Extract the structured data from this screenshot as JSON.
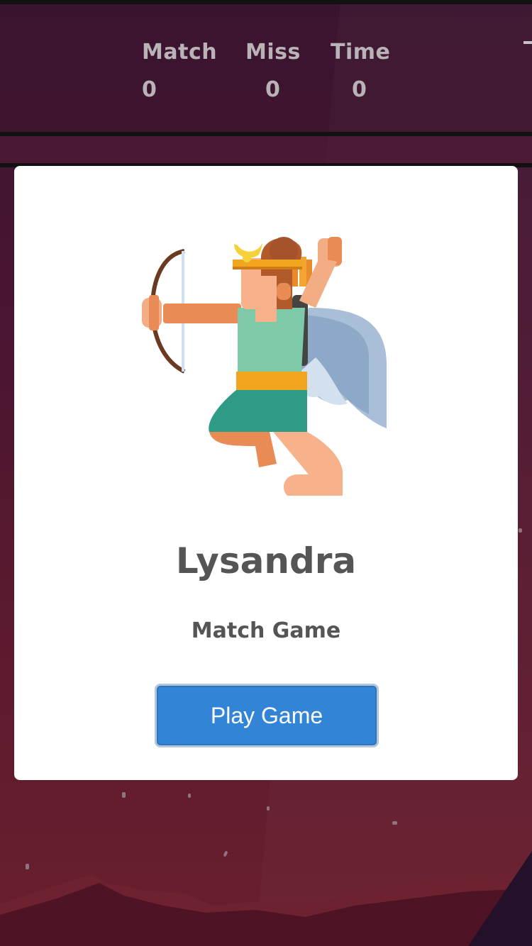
{
  "stats": {
    "match": {
      "label": "Match",
      "value": "0"
    },
    "miss": {
      "label": "Miss",
      "value": "0"
    },
    "time": {
      "label": "Time",
      "value": "0"
    }
  },
  "modal": {
    "character_name": "Lysandra",
    "game_title": "Match Game",
    "play_button_label": "Play Game",
    "hero_icon": "archer-character-icon"
  },
  "colors": {
    "play_button": "#3284d6",
    "modal_background": "#ffffff",
    "text_dark": "#555555",
    "stat_text": "#b9b3b8"
  }
}
